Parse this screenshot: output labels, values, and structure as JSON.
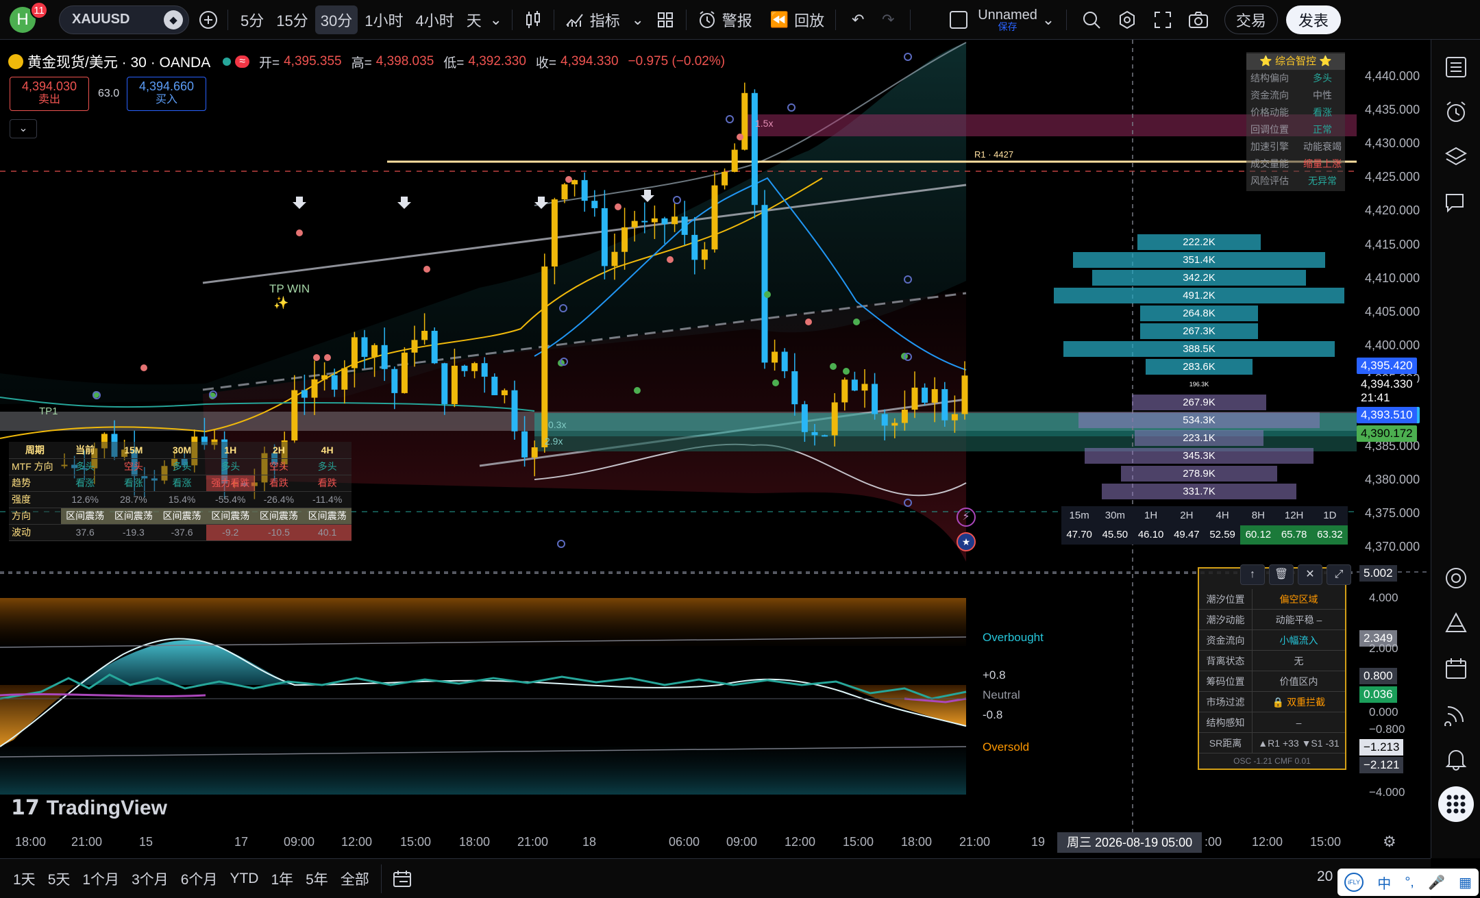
{
  "topbar": {
    "notif_count": "11",
    "avatar_letter": "H",
    "symbol": "XAUUSD",
    "timeframes": [
      "5分",
      "15分",
      "30分",
      "1小时",
      "4小时",
      "天"
    ],
    "active_tf": "30分",
    "indicators_label": "指标",
    "alert_label": "警报",
    "replay_label": "回放",
    "layout_name": "Unnamed",
    "layout_status": "保存",
    "trade_label": "交易",
    "publish_label": "发表"
  },
  "legend": {
    "title": "黄金现货/美元 · 30 · OANDA",
    "o_label": "开=",
    "o": "4,395.355",
    "h_label": "高=",
    "h": "4,398.035",
    "l_label": "低=",
    "l": "4,392.330",
    "c_label": "收=",
    "c": "4,394.330",
    "chg": "−0.975 (−0.02%)",
    "sell_price": "4,394.030",
    "sell_label": "卖出",
    "spread": "63.0",
    "buy_price": "4,394.660",
    "buy_label": "买入"
  },
  "price_axis": [
    "4,440.000",
    "4,435.000",
    "4,430.000",
    "4,425.000",
    "4,420.000",
    "4,415.000",
    "4,410.000",
    "4,405.000",
    "4,400.000",
    "4,395.000",
    "4,390.000",
    "4,385.000",
    "4,380.000",
    "4,375.000",
    "4,370.000"
  ],
  "price_pills": {
    "p1": "4,395.420",
    "last": "4,394.330",
    "countdown": "21:41",
    "p2": "4,393.510",
    "p3": "4,390.172"
  },
  "chart_labels": {
    "tp_win": "TP WIN",
    "tp1": "TP1",
    "r1": "R1 · 4427",
    "zone1": "1.5x",
    "zone2": "0.3x",
    "zone3": "2.9x"
  },
  "smart_panel": {
    "title": "⭐ 综合智控 ⭐",
    "rows": [
      {
        "k": "结构偏向",
        "v": "多头",
        "c": "#26a69a"
      },
      {
        "k": "资金流向",
        "v": "中性",
        "c": "#9598a1"
      },
      {
        "k": "价格动能",
        "v": "看涨",
        "c": "#26a69a"
      },
      {
        "k": "回调位置",
        "v": "正常",
        "c": "#26a69a"
      },
      {
        "k": "加速引擎",
        "v": "动能衰竭",
        "c": "#9598a1"
      },
      {
        "k": "成交量能",
        "v": "缩量上涨",
        "c": "#ef5350"
      },
      {
        "k": "风险评估",
        "v": "无异常",
        "c": "#26a69a"
      }
    ]
  },
  "volume_profile": [
    {
      "v": "222.2K",
      "c": "teal"
    },
    {
      "v": "351.4K",
      "c": "teal"
    },
    {
      "v": "342.2K",
      "c": "teal"
    },
    {
      "v": "491.2K",
      "c": "teal"
    },
    {
      "v": "264.8K",
      "c": "teal"
    },
    {
      "v": "267.3K",
      "c": "teal"
    },
    {
      "v": "388.5K",
      "c": "teal"
    },
    {
      "v": "283.6K",
      "c": "teal"
    },
    {
      "v": "196.3K",
      "c": "none"
    },
    {
      "v": "267.9K",
      "c": "purple"
    },
    {
      "v": "534.3K",
      "c": "purple"
    },
    {
      "v": "223.1K",
      "c": "purple"
    },
    {
      "v": "345.3K",
      "c": "purple"
    },
    {
      "v": "278.9K",
      "c": "purple"
    },
    {
      "v": "331.7K",
      "c": "purple"
    }
  ],
  "rsi_table": {
    "headers": [
      "15m",
      "30m",
      "1H",
      "2H",
      "4H",
      "8H",
      "12H",
      "1D"
    ],
    "values": [
      "47.70",
      "45.50",
      "46.10",
      "49.47",
      "52.59",
      "60.12",
      "65.78",
      "63.32"
    ]
  },
  "mtf_table": {
    "headers": [
      "周期",
      "当前",
      "15M",
      "30M",
      "1H",
      "2H",
      "4H"
    ],
    "rows": [
      [
        "MTF 方向",
        "多头",
        "空头",
        "多头",
        "多头",
        "空头",
        "多头"
      ],
      [
        "趋势",
        "看涨",
        "看涨",
        "看涨",
        "强力看跌",
        "看跌",
        "看跌"
      ],
      [
        "强度",
        "12.6%",
        "28.7%",
        "15.4%",
        "-55.4%",
        "-26.4%",
        "-11.4%"
      ],
      [
        "方向",
        "区间震荡",
        "区间震荡",
        "区间震荡",
        "区间震荡",
        "区间震荡",
        "区间震荡"
      ],
      [
        "波动",
        "37.6",
        "-19.3",
        "-37.6",
        "-9.2",
        "-10.5",
        "40.1"
      ]
    ]
  },
  "osc_labels": {
    "overbought": "Overbought",
    "plus": "+0.8",
    "neutral": "Neutral",
    "minus": "-0.8",
    "oversold": "Oversold"
  },
  "osc_axis": [
    "5.002",
    "4.000",
    "2.349",
    "2.000",
    "0.800",
    "0.036",
    "0.000",
    "−0.800",
    "−1.213",
    "−2.121",
    "−4.000"
  ],
  "tide_panel": {
    "rows": [
      {
        "k": "潮汐位置",
        "v": "偏空区域",
        "c": "#ff9800"
      },
      {
        "k": "潮汐动能",
        "v": "动能平稳 –",
        "c": "#b2b5be"
      },
      {
        "k": "资金流向",
        "v": "小幅流入",
        "c": "#26c6da"
      },
      {
        "k": "背离状态",
        "v": "无",
        "c": "#b2b5be"
      },
      {
        "k": "筹码位置",
        "v": "价值区内",
        "c": "#b2b5be"
      },
      {
        "k": "市场过滤",
        "v": "🔒 双重拦截",
        "c": "#ff9800"
      },
      {
        "k": "结构感知",
        "v": "–",
        "c": "#b2b5be"
      },
      {
        "k": "SR距离",
        "v": "▲R1 +33 ▼S1 -31",
        "c": "#b2b5be"
      }
    ],
    "footer": "OSC -1.21 CMF 0.01"
  },
  "time_axis": [
    "18:00",
    "21:00",
    "15",
    "17",
    "09:00",
    "12:00",
    "15:00",
    "18:00",
    "21:00",
    "18",
    "06:00",
    "09:00",
    "12:00",
    "15:00",
    "18:00",
    "21:00",
    "19",
    ":00",
    "12:00",
    "15:00"
  ],
  "crosshair_time": "周三 2026-08-19  05:00",
  "bottombar": {
    "ranges": [
      "1天",
      "5天",
      "1个月",
      "3个月",
      "6个月",
      "YTD",
      "1年",
      "5年",
      "全部"
    ],
    "right_text": "20"
  },
  "brand": "TradingView",
  "colors": {
    "up": "#f0b90b",
    "down": "#29b6f6",
    "accent": "#2962ff",
    "teal": "#26a69a",
    "red": "#ef5350"
  }
}
